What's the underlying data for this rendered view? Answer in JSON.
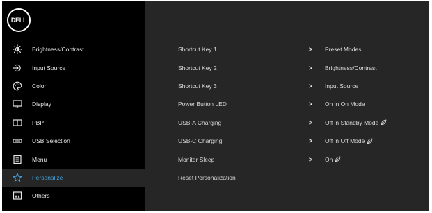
{
  "logo": {
    "text": "DELL"
  },
  "sidebar": {
    "items": [
      {
        "label": "Brightness/Contrast",
        "icon": "brightness-icon",
        "active": false
      },
      {
        "label": "Input Source",
        "icon": "input-source-icon",
        "active": false
      },
      {
        "label": "Color",
        "icon": "color-icon",
        "active": false
      },
      {
        "label": "Display",
        "icon": "display-icon",
        "active": false
      },
      {
        "label": "PBP",
        "icon": "pbp-icon",
        "active": false
      },
      {
        "label": "USB Selection",
        "icon": "usb-selection-icon",
        "active": false
      },
      {
        "label": "Menu",
        "icon": "menu-icon",
        "active": false
      },
      {
        "label": "Personalize",
        "icon": "star-icon",
        "active": true
      },
      {
        "label": "Others",
        "icon": "others-icon",
        "active": false
      }
    ]
  },
  "settings": {
    "rows": [
      {
        "label": "Shortcut Key 1",
        "chevron": ">",
        "value": "Preset Modes",
        "eco": false
      },
      {
        "label": "Shortcut Key 2",
        "chevron": ">",
        "value": "Brightness/Contrast",
        "eco": false
      },
      {
        "label": "Shortcut Key 3",
        "chevron": ">",
        "value": "Input Source",
        "eco": false
      },
      {
        "label": "Power Button LED",
        "chevron": ">",
        "value": "On in On Mode",
        "eco": false
      },
      {
        "label": "USB-A Charging",
        "chevron": ">",
        "value": "Off in Standby Mode",
        "eco": true
      },
      {
        "label": "USB-C Charging",
        "chevron": ">",
        "value": "Off in Off Mode",
        "eco": true
      },
      {
        "label": "Monitor Sleep",
        "chevron": ">",
        "value": "On",
        "eco": true
      },
      {
        "label": "Reset Personalization",
        "chevron": "",
        "value": "",
        "eco": false
      }
    ]
  },
  "colors": {
    "accent": "#45a3dc",
    "sidebar_bg": "#000000",
    "main_bg": "#262626"
  }
}
